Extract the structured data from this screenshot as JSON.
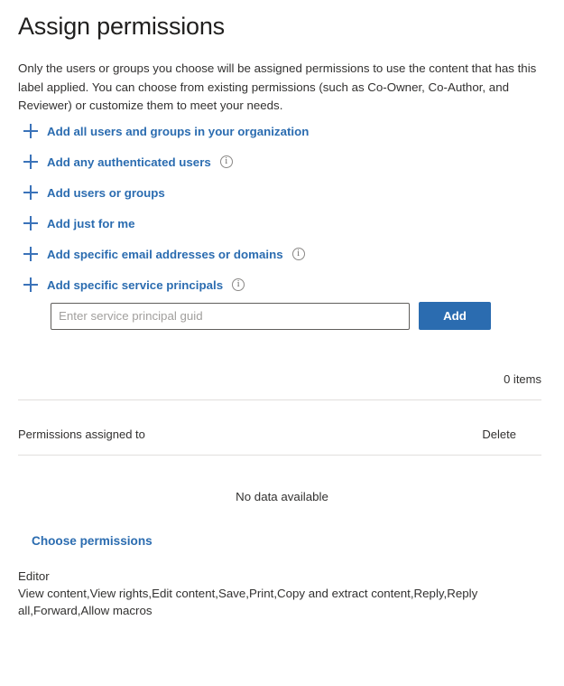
{
  "page": {
    "title": "Assign permissions",
    "description": "Only the users or groups you choose will be assigned permissions to use the content that has this label applied. You can choose from existing permissions (such as Co-Owner, Co-Author, and Reviewer) or customize them to meet your needs."
  },
  "actions": [
    {
      "label": "Add all users and groups in your organization",
      "icon": "plus-icon",
      "has_info": false
    },
    {
      "label": "Add any authenticated users",
      "icon": "plus-icon",
      "has_info": true
    },
    {
      "label": "Add users or groups",
      "icon": "plus-icon",
      "has_info": false
    },
    {
      "label": "Add just for me",
      "icon": "plus-icon",
      "has_info": false
    },
    {
      "label": "Add specific email addresses or domains",
      "icon": "plus-icon",
      "has_info": true
    },
    {
      "label": "Add specific service principals",
      "icon": "plus-icon",
      "has_info": true
    }
  ],
  "service_principal_input": {
    "placeholder": "Enter service principal guid",
    "value": "",
    "add_label": "Add"
  },
  "table": {
    "items_count": "0 items",
    "columns": {
      "name": "Permissions assigned to",
      "delete": "Delete"
    },
    "empty_message": "No data available",
    "rows": []
  },
  "permissions": {
    "choose_link": "Choose permissions",
    "role_name": "Editor",
    "rights": "View content,View rights,Edit content,Save,Print,Copy and extract content,Reply,Reply all,Forward,Allow macros"
  },
  "info_glyph": "i",
  "colors": {
    "accent_link": "#2b6cb0",
    "button_bg": "#2b6cb0",
    "text": "#323130",
    "divider": "#e1dfdd",
    "placeholder": "#a19f9d"
  }
}
